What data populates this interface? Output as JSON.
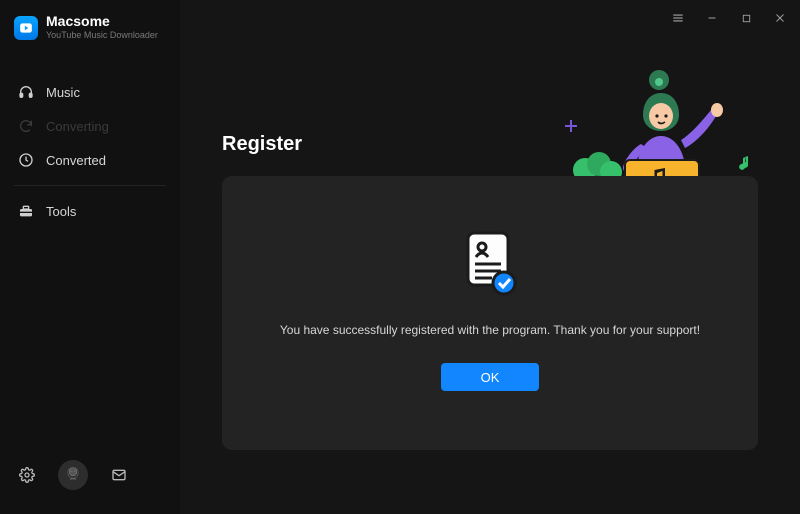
{
  "app": {
    "name": "Macsome",
    "subtitle": "YouTube Music Downloader"
  },
  "sidebar": {
    "items": [
      {
        "label": "Music"
      },
      {
        "label": "Converting"
      },
      {
        "label": "Converted"
      }
    ],
    "tools_label": "Tools"
  },
  "page": {
    "title": "Register"
  },
  "modal": {
    "message": "You have successfully registered with the program. Thank you for your support!",
    "ok_label": "OK"
  }
}
